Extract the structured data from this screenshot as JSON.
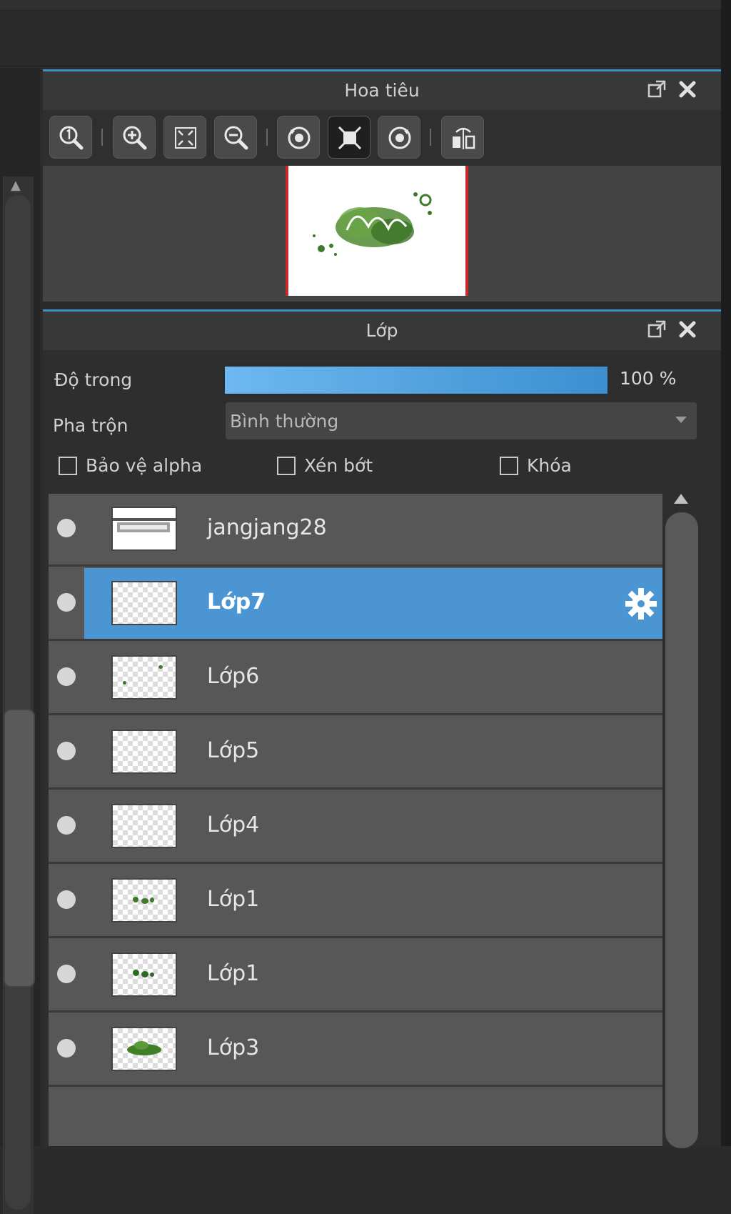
{
  "navigator": {
    "title": "Hoa tiêu",
    "toolbar": [
      {
        "icon": "zoom-actual-size-icon"
      },
      {
        "icon": "zoom-in-icon"
      },
      {
        "icon": "fit-to-window-icon"
      },
      {
        "icon": "zoom-out-icon"
      },
      {
        "icon": "rotate-left-icon"
      },
      {
        "icon": "reset-view-icon",
        "active": true
      },
      {
        "icon": "rotate-right-icon"
      },
      {
        "icon": "flip-horizontal-icon"
      }
    ]
  },
  "layers_panel": {
    "title": "Lớp",
    "opacity_label": "Độ trong",
    "opacity_value": "100 %",
    "opacity_fraction": 1.0,
    "blend_label": "Pha trộn",
    "blend_value": "Bình thường",
    "checkboxes": {
      "protect_alpha": "Bảo vệ alpha",
      "clipping": "Xén bớt",
      "lock": "Khóa"
    },
    "layers": [
      {
        "name": "jangjang28",
        "selected": false
      },
      {
        "name": "Lớp7",
        "selected": true
      },
      {
        "name": "Lớp6",
        "selected": false
      },
      {
        "name": "Lớp5",
        "selected": false
      },
      {
        "name": "Lớp4",
        "selected": false
      },
      {
        "name": "Lớp1",
        "selected": false
      },
      {
        "name": "Lớp1",
        "selected": false
      },
      {
        "name": "Lớp3",
        "selected": false
      }
    ]
  },
  "colors": {
    "accent": "#3d8fc6",
    "selection": "#4a95d2",
    "preview_border": "#cc2a2a"
  }
}
